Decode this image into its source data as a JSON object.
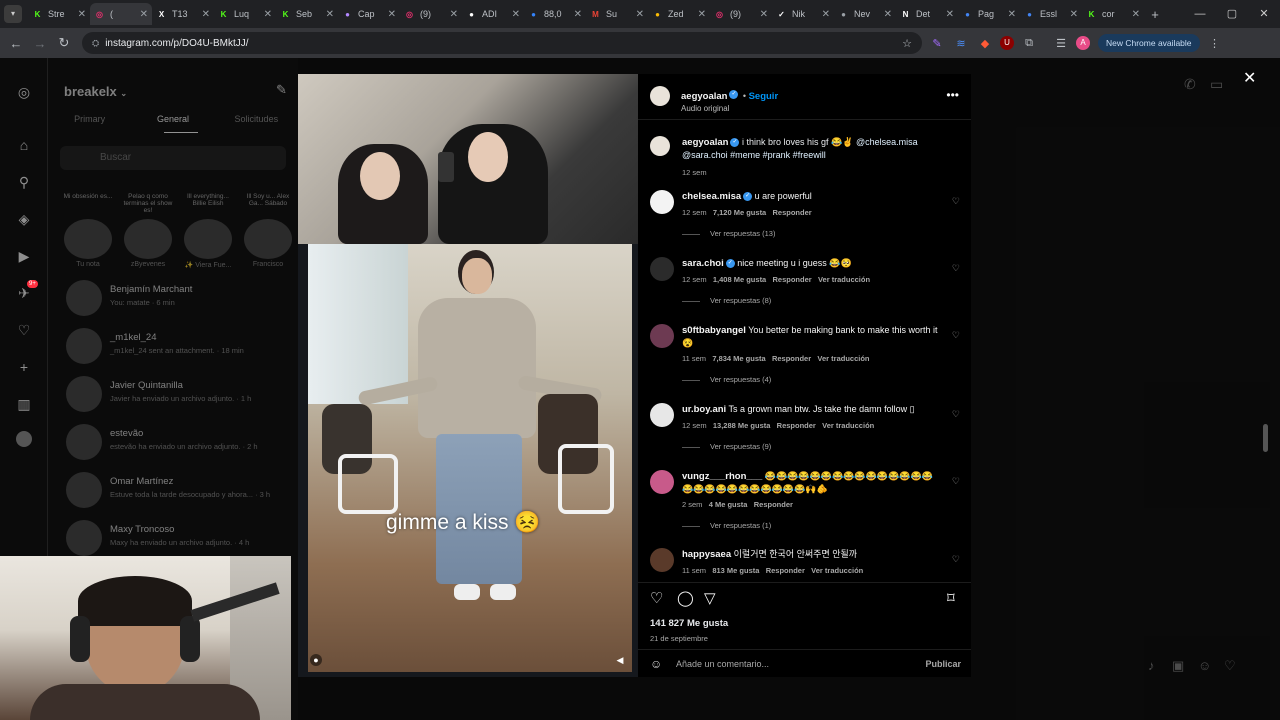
{
  "browser": {
    "tabs": [
      {
        "label": "Stre",
        "icon": "kick-icon",
        "color": "#53fc18"
      },
      {
        "label": "(",
        "icon": "instagram-icon",
        "color": "#e1306c",
        "active": true
      },
      {
        "label": "T13",
        "icon": "x-icon",
        "color": "#ffffff"
      },
      {
        "label": "Luq",
        "icon": "kick-icon",
        "color": "#53fc18"
      },
      {
        "label": "Seb",
        "icon": "kick-icon",
        "color": "#53fc18"
      },
      {
        "label": "Cap",
        "icon": "feather-icon",
        "color": "#b388ff"
      },
      {
        "label": "(9)",
        "icon": "instagram-icon",
        "color": "#e1306c"
      },
      {
        "label": "ADI",
        "icon": "adidas-icon",
        "color": "#ffffff"
      },
      {
        "label": "88,0",
        "icon": "mercadolibre-icon",
        "color": "#3483fa"
      },
      {
        "label": "Su",
        "icon": "gmail-icon",
        "color": "#ea4335"
      },
      {
        "label": "Zed",
        "icon": "pin-icon",
        "color": "#fbbc04"
      },
      {
        "label": "(9)",
        "icon": "instagram-icon",
        "color": "#e1306c"
      },
      {
        "label": "Nik",
        "icon": "nike-icon",
        "color": "#ffffff"
      },
      {
        "label": "Nev",
        "icon": "globe-icon",
        "color": "#9aa0a6"
      },
      {
        "label": "Det",
        "icon": "notion-icon",
        "color": "#ffffff"
      },
      {
        "label": "Pag",
        "icon": "globe-icon",
        "color": "#4285f4"
      },
      {
        "label": "Essl",
        "icon": "docs-icon",
        "color": "#4285f4"
      },
      {
        "label": "cor",
        "icon": "kick-icon",
        "color": "#53fc18"
      }
    ],
    "url": "instagram.com/p/DO4U-BMktJJ/",
    "new_chrome": "New Chrome available",
    "profile_initial": "A"
  },
  "dm": {
    "username": "breakelx",
    "tabs": [
      "Primary",
      "General",
      "Solicitudes"
    ],
    "active_tab": "General",
    "search_placeholder": "Buscar",
    "notes": [
      {
        "text": "Mi obsesión es...",
        "name": "Tu nota"
      },
      {
        "text": "Pelao q como terminas el show es!",
        "name": "zByevenes"
      },
      {
        "text": "Ill everything... Billie Eilish",
        "name": "✨ Viera Fue..."
      },
      {
        "text": "Ill Soy u... Alex Ga... Sábado",
        "name": "Francisco"
      }
    ],
    "chats": [
      {
        "name": "Benjamín Marchant",
        "preview": "You: matate · 6 min"
      },
      {
        "name": "_m1kel_24",
        "preview": "_m1kel_24 sent an attachment. · 18 min"
      },
      {
        "name": "Javier Quintanilla",
        "preview": "Javier ha enviado un archivo adjunto. · 1 h"
      },
      {
        "name": "estevão",
        "preview": "estevão ha enviado un archivo adjunto. · 2 h"
      },
      {
        "name": "Omar Martínez",
        "preview": "Estuve toda la tarde desocupado y ahora... · 3 h"
      },
      {
        "name": "Maxy Troncoso",
        "preview": "Maxy ha enviado un archivo adjunto. · 4 h"
      }
    ],
    "badge": "9+"
  },
  "post": {
    "author": "aegyoalan",
    "follow": "Seguir",
    "audio": "Audio original",
    "media_caption": "gimme a kiss 😣",
    "caption": {
      "user": "aegyoalan",
      "text": "i think bro loves his gf 😂✌️",
      "mention": "@chelsea.misa",
      "rest": "@sara.choi #meme #prank #freewill",
      "time": "12 sem"
    },
    "comments": [
      {
        "user": "chelsea.misa",
        "verified": true,
        "text": "u are powerful",
        "time": "12 sem",
        "likes": "7,120 Me gusta",
        "reply": "Responder",
        "translate": "",
        "replies": "Ver respuestas (13)"
      },
      {
        "user": "sara.choi",
        "verified": true,
        "text": "nice meeting u i guess 😂🥺",
        "time": "12 sem",
        "likes": "1,408 Me gusta",
        "reply": "Responder",
        "translate": "Ver traducción",
        "replies": "Ver respuestas (8)"
      },
      {
        "user": "s0ftbabyangel",
        "verified": false,
        "text": "You better be making bank to make this worth it 😵",
        "time": "11 sem",
        "likes": "7,834 Me gusta",
        "reply": "Responder",
        "translate": "Ver traducción",
        "replies": "Ver respuestas (4)"
      },
      {
        "user": "ur.boy.ani",
        "verified": false,
        "text": "Ts a grown man btw. Js take the damn follow ▯",
        "time": "12 sem",
        "likes": "13,288 Me gusta",
        "reply": "Responder",
        "translate": "Ver traducción",
        "replies": "Ver respuestas (9)"
      },
      {
        "user": "vungz___rhon___",
        "verified": false,
        "text": "😂😂😂😂😂😂😂😂😂😂😂😂😂😂😂😂😂😂😂😂😂😂😂😂😂😂🙌🫵",
        "time": "2 sem",
        "likes": "4 Me gusta",
        "reply": "Responder",
        "translate": "",
        "replies": "Ver respuestas (1)"
      },
      {
        "user": "happysaea",
        "verified": false,
        "text": "이럴거면 한국어 안써주면 안될까",
        "time": "11 sem",
        "likes": "813 Me gusta",
        "reply": "Responder",
        "translate": "Ver traducción",
        "replies": ""
      }
    ],
    "likes": "141 827 Me gusta",
    "date": "21 de septiembre",
    "comment_placeholder": "Añade un comentario...",
    "publish": "Publicar"
  }
}
